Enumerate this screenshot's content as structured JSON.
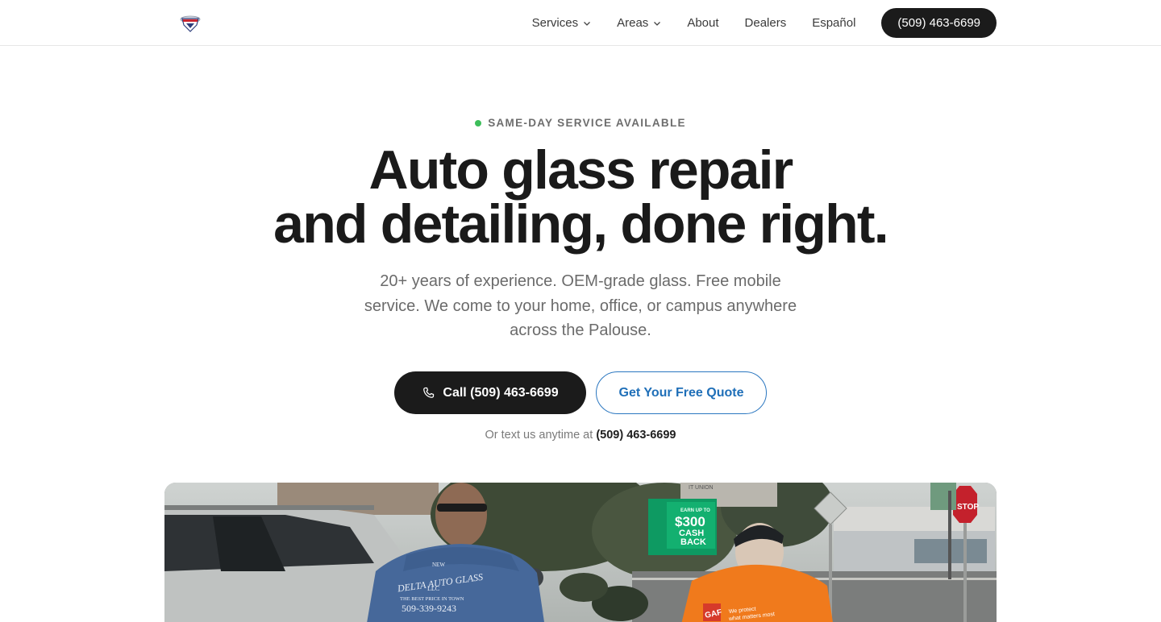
{
  "nav": {
    "logo_icon": "shield-logo-icon",
    "items": [
      {
        "label": "Services",
        "has_dropdown": true
      },
      {
        "label": "Areas",
        "has_dropdown": true
      },
      {
        "label": "About",
        "has_dropdown": false
      },
      {
        "label": "Dealers",
        "has_dropdown": false
      },
      {
        "label": "Español",
        "has_dropdown": false
      }
    ],
    "phone_button": "(509) 463-6699"
  },
  "hero": {
    "eyebrow": "SAME-DAY SERVICE AVAILABLE",
    "headline_line1": "Auto glass repair",
    "headline_line2": "and detailing, done right.",
    "subtext": "20+ years of experience. OEM-grade glass. Free mobile service. We come to your home, office, or campus anywhere across the Palouse.",
    "call_button": "Call (509) 463-6699",
    "quote_button": "Get Your Free Quote",
    "text_prefix": "Or text us anytime at",
    "text_number": "(509) 463-6699"
  },
  "photo": {
    "shirt_left_line1": "NEW",
    "shirt_left_line2": "DELTA AUTO GLASS",
    "shirt_left_line3": "LLC",
    "shirt_left_line4": "THE BEST PRICE IN TOWN",
    "shirt_left_phone": "509-339-9243",
    "sign_line1": "EARN UP TO",
    "sign_line2": "$300",
    "sign_line3": "CASH",
    "sign_line4": "BACK",
    "building_sign": "IT UNION",
    "stop_sign": "STOP",
    "shirt_right_logo": "GAF",
    "shirt_right_text1": "We protect",
    "shirt_right_text2": "what matters most"
  },
  "colors": {
    "dark": "#1b1b1b",
    "accent_blue": "#1f6fb8",
    "status_green": "#3dbe5a"
  }
}
